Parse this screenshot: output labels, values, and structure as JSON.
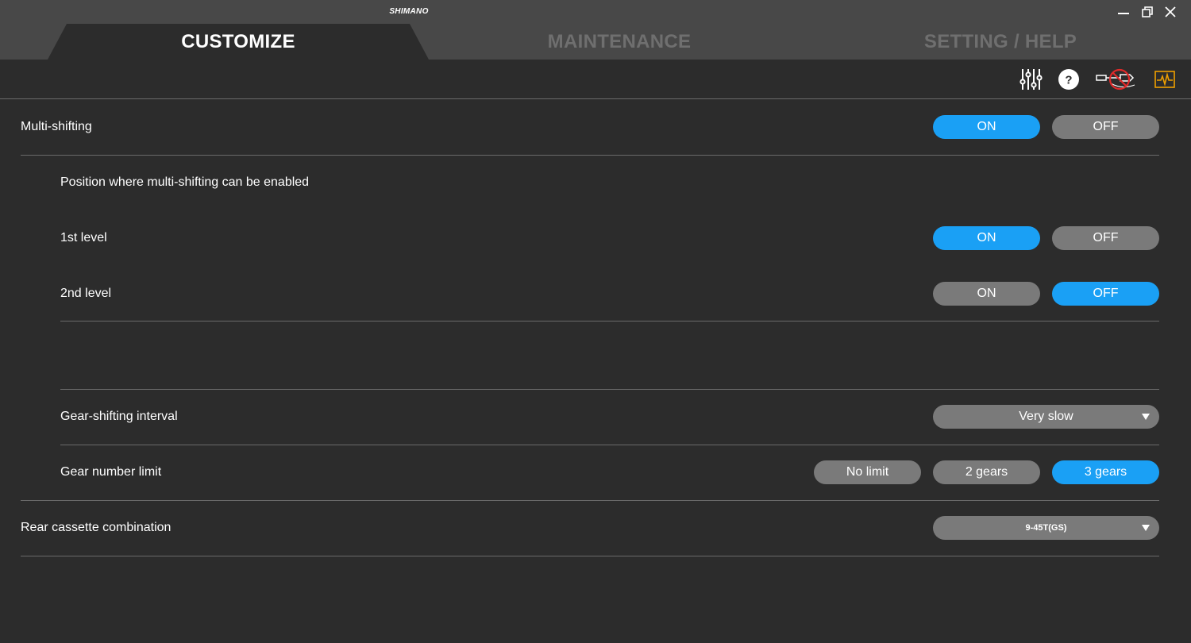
{
  "app": {
    "brand": "SHIMANO"
  },
  "tabs": [
    {
      "label": "CUSTOMIZE",
      "active": true
    },
    {
      "label": "MAINTENANCE",
      "active": false
    },
    {
      "label": "SETTING / HELP",
      "active": false
    }
  ],
  "toolbar_icons": [
    "sliders-icon",
    "help-icon",
    "no-connection-icon",
    "monitor-icon"
  ],
  "colors": {
    "accent": "#1aa0f5",
    "inactive_pill": "#7a7a7a",
    "background": "#2c2c2c",
    "titlebar": "#484848",
    "monitor_icon": "#f0a000"
  },
  "settings": {
    "multi_shifting": {
      "label": "Multi-shifting",
      "on": "ON",
      "off": "OFF",
      "selected": "ON"
    },
    "position_heading": "Position where multi-shifting can be enabled",
    "level1": {
      "label": "1st level",
      "on": "ON",
      "off": "OFF",
      "selected": "ON"
    },
    "level2": {
      "label": "2nd level",
      "on": "ON",
      "off": "OFF",
      "selected": "OFF"
    },
    "interval": {
      "label": "Gear-shifting interval",
      "value": "Very slow"
    },
    "gear_limit": {
      "label": "Gear number limit",
      "options": [
        "No limit",
        "2 gears",
        "3 gears"
      ],
      "selected": "3 gears"
    },
    "cassette": {
      "label": "Rear cassette combination",
      "value": "9-45T(GS)"
    }
  }
}
